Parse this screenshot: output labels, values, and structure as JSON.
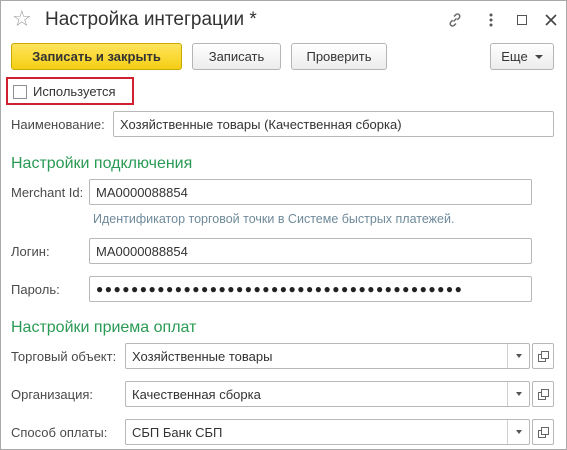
{
  "window": {
    "title": "Настройка интеграции *"
  },
  "toolbar": {
    "save_close_label": "Записать и закрыть",
    "save_label": "Записать",
    "check_label": "Проверить",
    "more_label": "Еще"
  },
  "used_checkbox": {
    "label": "Используется",
    "checked": false
  },
  "name_field": {
    "label": "Наименование:",
    "value": "Хозяйственные товары (Качественная сборка)"
  },
  "connection": {
    "heading": "Настройки подключения",
    "merchant_label": "Merchant Id:",
    "merchant_value": "MA0000088854",
    "merchant_hint": "Идентификатор торговой точки в Системе быстрых платежей.",
    "login_label": "Логин:",
    "login_value": "MA0000088854",
    "password_label": "Пароль:",
    "password_value": "●●●●●●●●●●●●●●●●●●●●●●●●●●●●●●●●●●●●●●●●●●"
  },
  "payment": {
    "heading": "Настройки приема оплат",
    "trade_object_label": "Торговый объект:",
    "trade_object_value": "Хозяйственные товары",
    "organization_label": "Организация:",
    "organization_value": "Качественная сборка",
    "payment_method_label": "Способ оплаты:",
    "payment_method_value": "СБП Банк СБП"
  },
  "colors": {
    "accent_button": "#f5cf14",
    "section_heading": "#2a9a54",
    "highlight_border": "#d02030",
    "hint_text": "#6f8a9a"
  },
  "icons": [
    "star-icon",
    "link-icon",
    "more-vertical-icon",
    "maximize-icon",
    "close-icon",
    "chevron-down-icon",
    "open-form-icon"
  ]
}
